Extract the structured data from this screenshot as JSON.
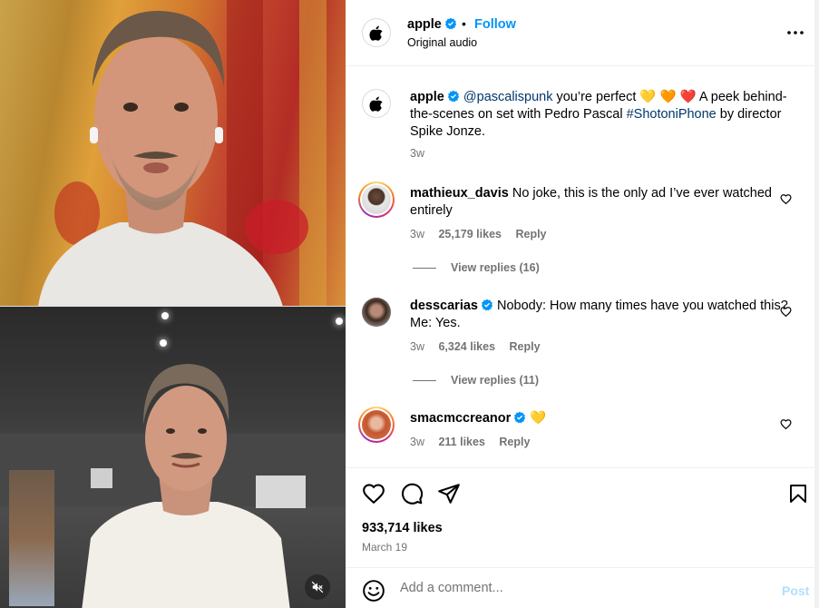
{
  "header": {
    "username": "apple",
    "separator": "•",
    "follow_label": "Follow",
    "audio": "Original audio",
    "more_icon": "more-horizontal-icon"
  },
  "caption": {
    "username": "apple",
    "mention": "@pascalispunk",
    "text_before_emoji": " you’re perfect ",
    "emojis": "💛 🧡 ❤️",
    "text_after_emoji": " A peek behind-the-scenes on set with Pedro Pascal ",
    "hashtag": "#ShotoniPhone",
    "text_end": " by director Spike Jonze.",
    "age": "3w"
  },
  "comments": [
    {
      "username": "mathieux_davis",
      "text": " No joke, this is the only ad I’ve ever watched entirely",
      "age": "3w",
      "likes": "25,179 likes",
      "reply_label": "Reply",
      "view_replies": "View replies (16)"
    },
    {
      "username": "desscarias",
      "text": " Nobody: How many times have you watched this? Me: Yes.",
      "age": "3w",
      "likes": "6,324 likes",
      "reply_label": "Reply",
      "view_replies": "View replies (11)"
    },
    {
      "username": "smacmccreanor",
      "text": " 💛",
      "age": "3w",
      "likes": "211 likes",
      "reply_label": "Reply"
    }
  ],
  "actions": {
    "likes": "933,714 likes",
    "date": "March 19"
  },
  "comment_box": {
    "placeholder": "Add a comment...",
    "post_label": "Post"
  },
  "colors": {
    "accent": "#0095f6",
    "verified": "#0095f6",
    "muted_text": "#737373",
    "post_disabled": "#b2dffc"
  }
}
